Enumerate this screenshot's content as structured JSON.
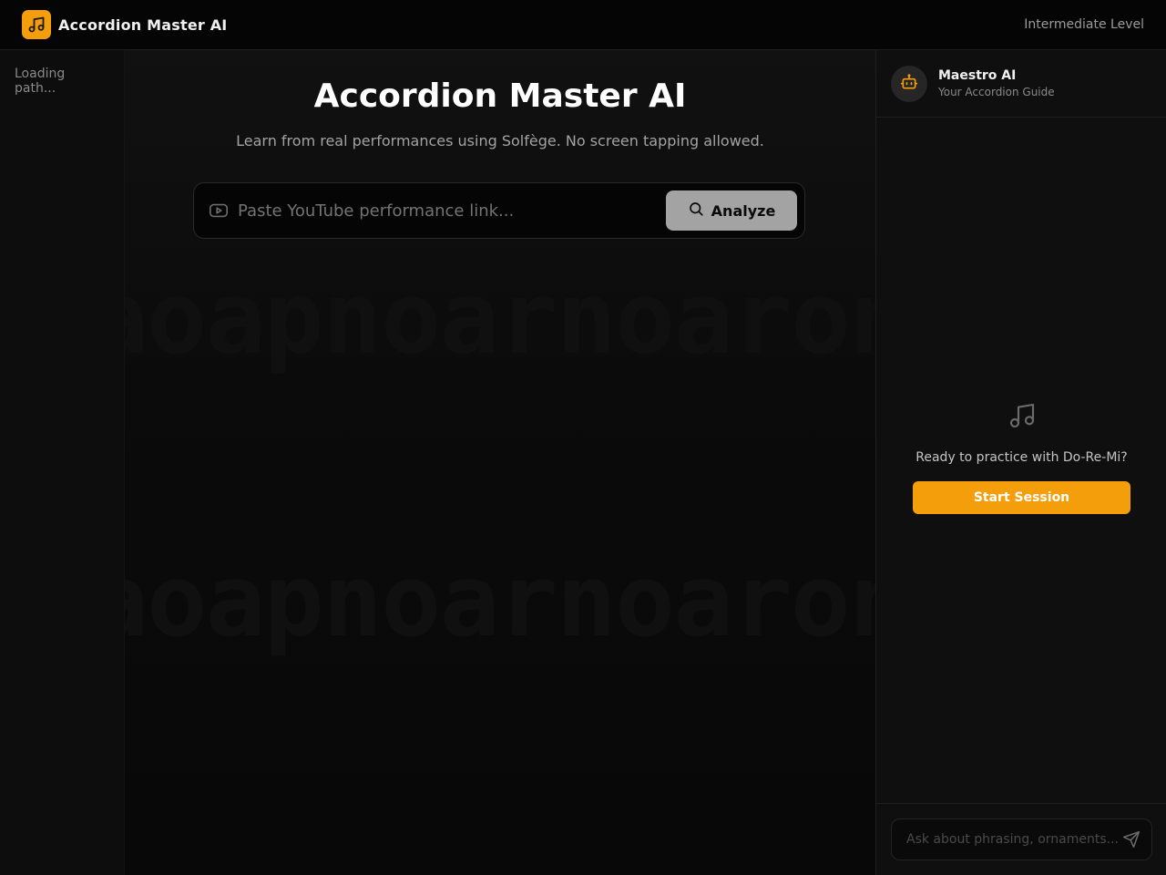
{
  "header": {
    "brand_name": "Accordion Master AI",
    "level": "Intermediate Level",
    "logo_icon": "music-note-icon"
  },
  "sidebar": {
    "loading_text": "Loading path..."
  },
  "main": {
    "title": "Accordion Master AI",
    "subtitle": "Learn from real performances using Solfège. No screen tapping allowed.",
    "search": {
      "placeholder": "Paste YouTube performance link...",
      "value": "",
      "button_label": "Analyze"
    }
  },
  "chat": {
    "bot_name": "Maestro AI",
    "bot_role": "Your Accordion Guide",
    "empty_message": "Ready to practice with Do-Re-Mi?",
    "start_button": "Start Session",
    "input_placeholder": "Ask about phrasing, ornaments...",
    "input_value": ""
  },
  "colors": {
    "accent": "#f59e0b",
    "background": "#0a0a0a",
    "analyze_button": "#a3a3a3"
  }
}
